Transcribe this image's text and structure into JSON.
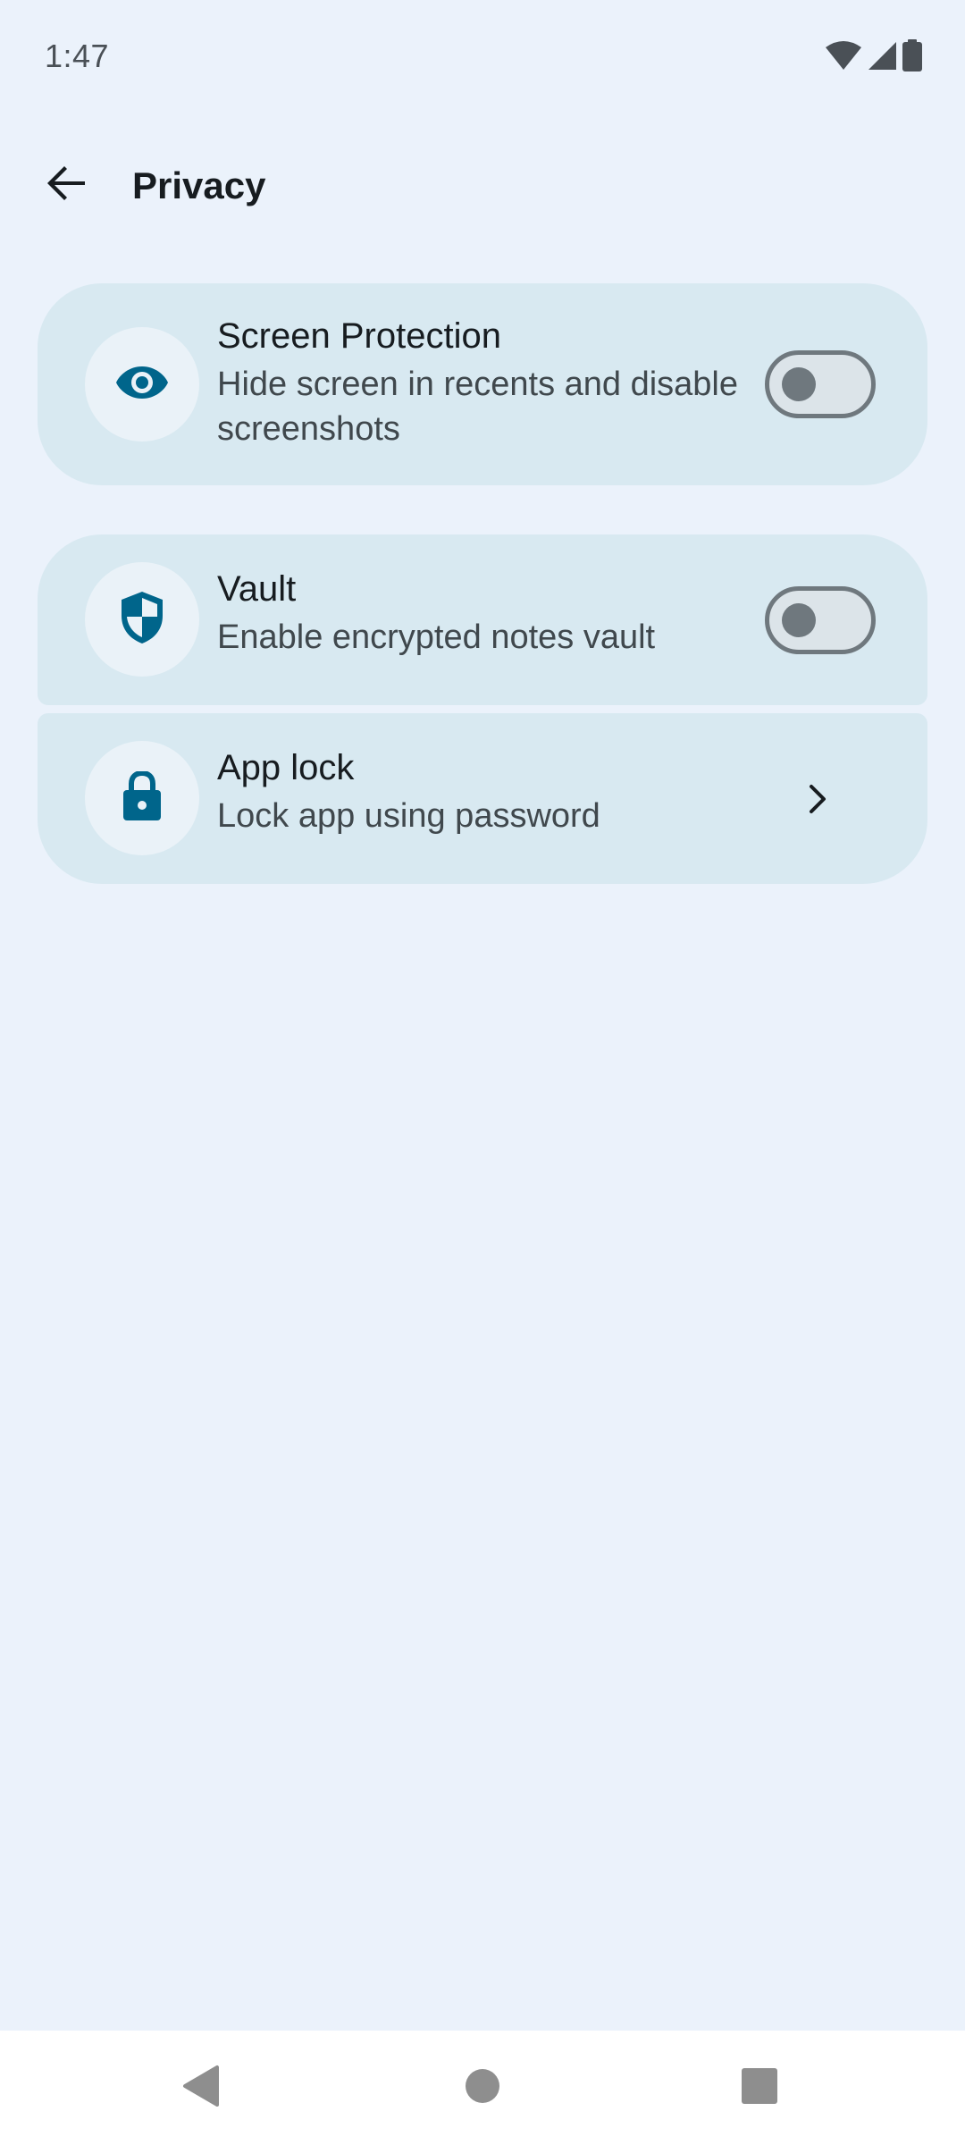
{
  "status_bar": {
    "time": "1:47",
    "icons": [
      "wifi-icon",
      "cellular-signal-icon",
      "battery-icon"
    ]
  },
  "header": {
    "title": "Privacy",
    "back_icon": "arrow-back-icon"
  },
  "settings": [
    {
      "id": "screen-protection",
      "icon": "eye-icon",
      "title": "Screen Protection",
      "subtitle": "Hide screen in recents and disable screenshots",
      "control": "switch",
      "enabled": false
    },
    {
      "id": "vault",
      "icon": "shield-icon",
      "title": "Vault",
      "subtitle": "Enable encrypted notes vault",
      "control": "switch",
      "enabled": false
    },
    {
      "id": "app-lock",
      "icon": "lock-icon",
      "title": "App lock",
      "subtitle": "Lock app using password",
      "control": "chevron"
    }
  ],
  "nav_bar": {
    "buttons": [
      "nav-back-icon",
      "nav-home-icon",
      "nav-recents-icon"
    ]
  },
  "colors": {
    "background": "#EBF2FB",
    "card": "#D8E9F1",
    "icon_circle": "#EAF2F8",
    "accent": "#00658B",
    "switch_outline": "#6F787E",
    "switch_track": "#DCE4E9"
  }
}
